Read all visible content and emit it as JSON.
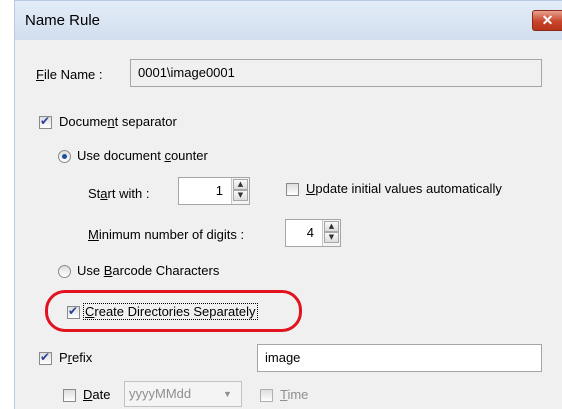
{
  "window": {
    "title": "Name Rule",
    "close_glyph": "✕"
  },
  "file_name": {
    "label_prefix": "",
    "label_hotkey": "F",
    "label_rest": "ile Name :",
    "value": "0001\\image0001"
  },
  "document_separator": {
    "checked": true,
    "label_pre": "Docume",
    "label_hotkey": "n",
    "label_post": "t separator"
  },
  "use_document_counter": {
    "selected": true,
    "label_pre": "Use document ",
    "label_hotkey": "c",
    "label_post": "ounter"
  },
  "start_with": {
    "label_pre": "St",
    "label_hotkey": "a",
    "label_post": "rt with :",
    "value": "1"
  },
  "update_initial_values": {
    "checked": false,
    "label_hotkey": "U",
    "label_post": "pdate initial values automatically"
  },
  "minimum_digits": {
    "label_hotkey": "M",
    "label_post": "inimum number of digits :",
    "value": "4"
  },
  "use_barcode_characters": {
    "selected": false,
    "label_pre": "Use ",
    "label_hotkey": "B",
    "label_post": "arcode Characters"
  },
  "create_directories": {
    "checked": true,
    "label_pre": "",
    "label_hotkey": "C",
    "label_post": "reate Directories Separately"
  },
  "prefix": {
    "checked": true,
    "label_pre": "P",
    "label_hotkey": "r",
    "label_post": "efix",
    "value": "image"
  },
  "date": {
    "checked": false,
    "label_hotkey": "D",
    "label_post": "ate",
    "format": "yyyyMMdd"
  },
  "time": {
    "checked": false,
    "label_hotkey": "T",
    "label_post": "ime"
  },
  "colors": {
    "highlight": "#e0131f",
    "close_button": "#c8452c",
    "dialog_bg": "#f0f0f0"
  }
}
